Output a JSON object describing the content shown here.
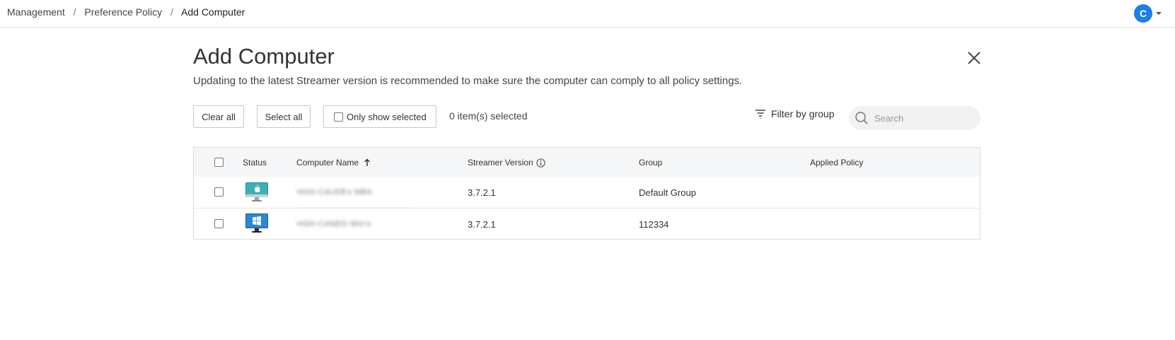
{
  "breadcrumb": {
    "items": [
      "Management",
      "Preference Policy"
    ],
    "current": "Add Computer",
    "separator": "/"
  },
  "user": {
    "initial": "C",
    "avatar_color": "#1a80e5"
  },
  "dialog": {
    "title": "Add Computer",
    "subtitle": "Updating to the latest Streamer version is recommended to make sure the computer can comply to all policy settings."
  },
  "toolbar": {
    "clear_all": "Clear all",
    "select_all": "Select all",
    "only_show_selected": "Only show selected",
    "selected_count": "0 item(s) selected",
    "filter_label": "Filter by group",
    "search_placeholder": "Search"
  },
  "table": {
    "columns": {
      "status": "Status",
      "computer_name": "Computer Name",
      "streamer_version": "Streamer Version",
      "group": "Group",
      "applied_policy": "Applied Policy"
    },
    "rows": [
      {
        "os": "mac",
        "status_icon": "mac-computer-icon",
        "name": "HGH-CALEB's MBA",
        "version": "3.7.2.1",
        "group": "Default Group",
        "policy": ""
      },
      {
        "os": "windows",
        "status_icon": "windows-computer-icon",
        "name": "HGH-CANED-Win's",
        "version": "3.7.2.1",
        "group": "112334",
        "policy": ""
      }
    ]
  }
}
